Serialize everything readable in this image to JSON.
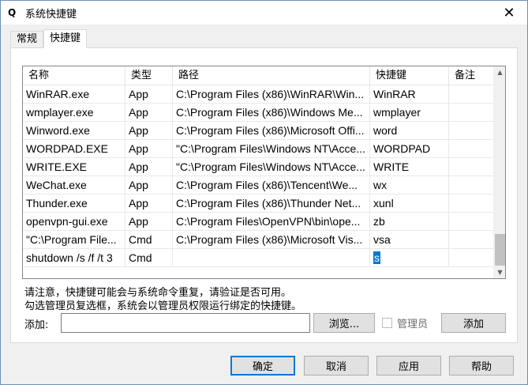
{
  "window": {
    "title": "系统快捷键",
    "app_icon": "Q",
    "close_glyph": "✕"
  },
  "tabs": [
    {
      "label": "常规"
    },
    {
      "label": "快捷键"
    }
  ],
  "table": {
    "columns": [
      "名称",
      "类型",
      "路径",
      "快捷键",
      "备注"
    ],
    "rows": [
      [
        "WinRAR.exe",
        "App",
        "C:\\Program Files (x86)\\WinRAR\\Win...",
        "WinRAR",
        ""
      ],
      [
        "wmplayer.exe",
        "App",
        "C:\\Program Files (x86)\\Windows Me...",
        "wmplayer",
        ""
      ],
      [
        "Winword.exe",
        "App",
        "C:\\Program Files (x86)\\Microsoft Offi...",
        "word",
        ""
      ],
      [
        "WORDPAD.EXE",
        "App",
        "\"C:\\Program Files\\Windows NT\\Acce...",
        "WORDPAD",
        ""
      ],
      [
        "WRITE.EXE",
        "App",
        "\"C:\\Program Files\\Windows NT\\Acce...",
        "WRITE",
        ""
      ],
      [
        "WeChat.exe",
        "App",
        "C:\\Program Files (x86)\\Tencent\\We...",
        "wx",
        ""
      ],
      [
        "Thunder.exe",
        "App",
        "C:\\Program Files (x86)\\Thunder Net...",
        "xunl",
        ""
      ],
      [
        "openvpn-gui.exe",
        "App",
        "C:\\Program Files\\OpenVPN\\bin\\ope...",
        "zb",
        ""
      ],
      [
        "\"C:\\Program File...",
        "Cmd",
        "C:\\Program Files (x86)\\Microsoft Vis...",
        "vsa",
        ""
      ],
      [
        "shutdown /s /f /t 3",
        "Cmd",
        "",
        "s",
        ""
      ]
    ]
  },
  "notes": {
    "line1": "请注意，快捷键可能会与系统命令重复，请验证是否可用。",
    "line2": "勾选管理员复选框，系统会以管理员权限运行绑定的快捷键。"
  },
  "add_row": {
    "label": "添加:",
    "input_value": "",
    "browse_label": "浏览...",
    "admin_label": "管理员",
    "admin_checked": false,
    "add_label": "添加"
  },
  "buttons": {
    "ok": "确定",
    "cancel": "取消",
    "apply": "应用",
    "help": "帮助"
  }
}
